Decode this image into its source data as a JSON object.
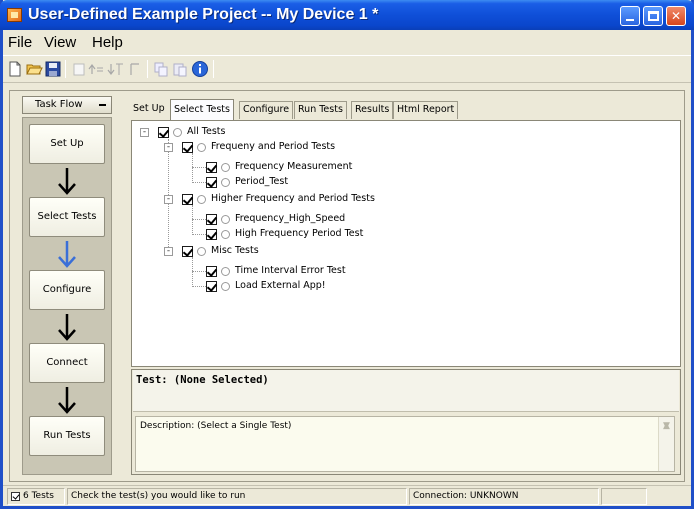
{
  "window": {
    "title": "User-Defined Example Project -- My Device 1 *",
    "controls": {
      "minimize_icon": "minimize-icon",
      "maximize_icon": "maximize-icon",
      "close_label": "✕"
    }
  },
  "menu": {
    "file": "File",
    "view": "View",
    "help": "Help"
  },
  "toolbar": {
    "icons": [
      "new-file-icon",
      "open-folder-icon",
      "save-icon",
      "page-icon",
      "move-up-icon",
      "move-down-icon",
      "toggle-icon",
      "copy-icon",
      "paste-icon",
      "info-icon"
    ]
  },
  "task_flow": {
    "header": "Task Flow",
    "steps": [
      "Set Up",
      "Select Tests",
      "Configure",
      "Connect",
      "Run Tests"
    ],
    "active_arrow_color": "#3a6fd8",
    "arrow_color": "#000000"
  },
  "tabs": [
    "Set Up",
    "Select Tests",
    "Configure",
    "Run Tests",
    "Results",
    "Html Report"
  ],
  "active_tab": "Select Tests",
  "tree": {
    "root": "All Tests",
    "groups": [
      {
        "label": "Frequeny and Period Tests",
        "tests": [
          "Frequency Measurement",
          "Period_Test"
        ]
      },
      {
        "label": "Higher Frequency and Period Tests",
        "tests": [
          "Frequency_High_Speed",
          "High Frequency Period Test"
        ]
      },
      {
        "label": "Misc Tests",
        "tests": [
          "Time Interval Error Test",
          "Load External App!"
        ]
      }
    ]
  },
  "info": {
    "test_header": "Test: (None Selected)",
    "description": "Description: (Select a Single Test)"
  },
  "status": {
    "tests_count": "6 Tests",
    "hint": "Check the test(s) you would like to run",
    "connection": "Connection: UNKNOWN"
  },
  "colors": {
    "title_bar": "#0f4fd8",
    "window_bg": "#ece9d8",
    "close_button": "#d6461e"
  }
}
